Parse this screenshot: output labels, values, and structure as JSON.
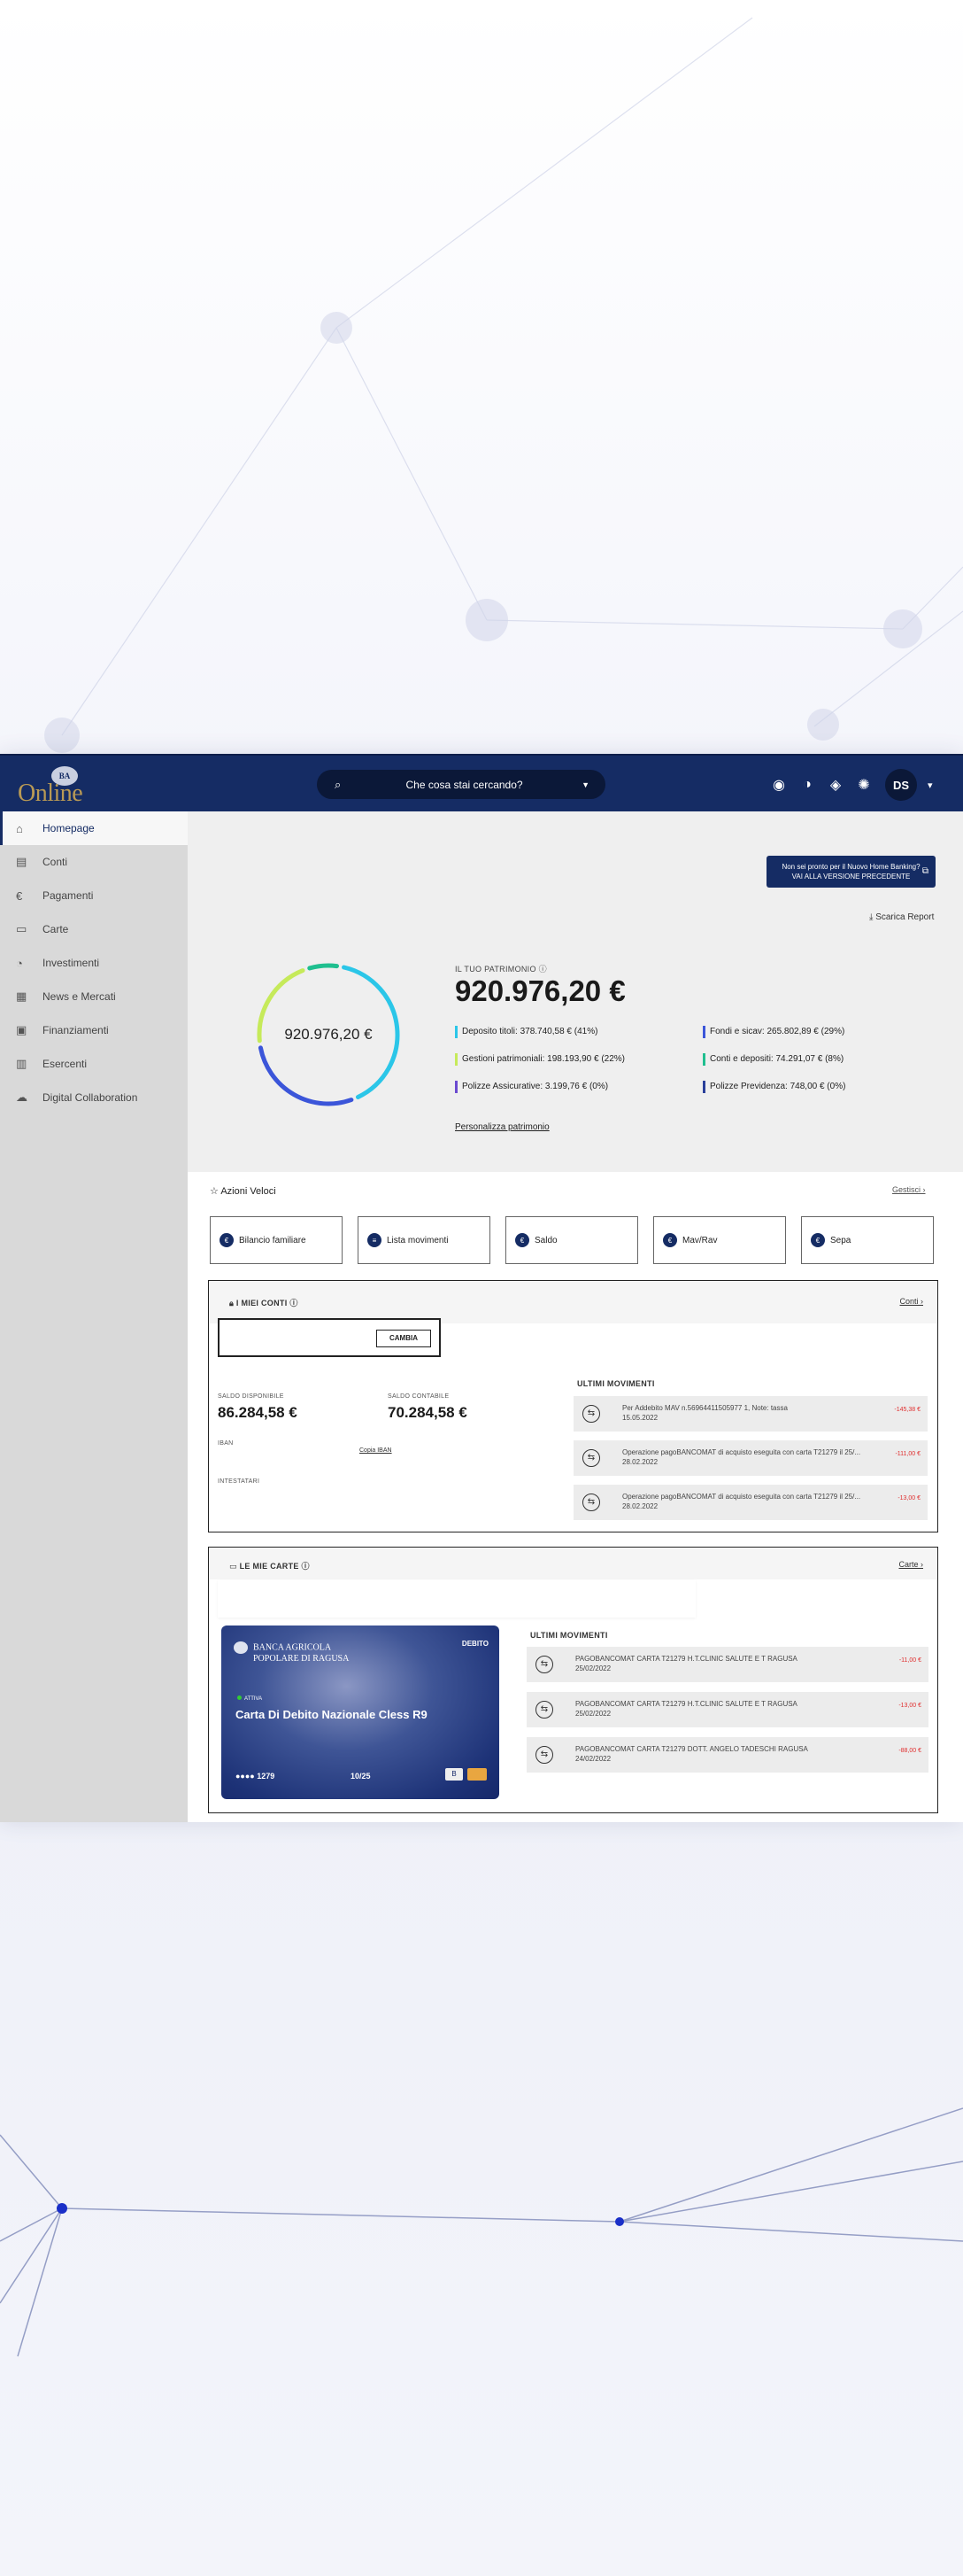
{
  "header": {
    "logo_text": "Online",
    "search_placeholder": "Che cosa stai cercando?",
    "avatar_initials": "DS"
  },
  "sidebar": {
    "items": [
      {
        "label": "Homepage",
        "icon": "home-icon"
      },
      {
        "label": "Conti",
        "icon": "bank-icon"
      },
      {
        "label": "Pagamenti",
        "icon": "euro-icon"
      },
      {
        "label": "Carte",
        "icon": "card-icon"
      },
      {
        "label": "Investimenti",
        "icon": "chart-icon"
      },
      {
        "label": "News e Mercati",
        "icon": "news-icon"
      },
      {
        "label": "Finanziamenti",
        "icon": "loan-icon"
      },
      {
        "label": "Esercenti",
        "icon": "store-icon"
      },
      {
        "label": "Digital Collaboration",
        "icon": "collab-icon"
      }
    ]
  },
  "promo": {
    "line1": "Non sei pronto per il Nuovo Home Banking?",
    "line2": "VAI ALLA VERSIONE PRECEDENTE"
  },
  "download_label": "Scarica Report",
  "patrimonio": {
    "label": "IL TUO PATRIMONIO",
    "total": "920.976,20 €",
    "ring_center": "920.976,20 €",
    "personalize": "Personalizza patrimonio",
    "items": [
      {
        "text": "Deposito titoli: 378.740,58 € (41%)",
        "color": "#2bc6e8",
        "pct": 41
      },
      {
        "text": "Fondi e sicav: 265.802,89 € (29%)",
        "color": "#3b55d9",
        "pct": 29
      },
      {
        "text": "Gestioni patrimoniali: 198.193,90 € (22%)",
        "color": "#c6ea5a",
        "pct": 22
      },
      {
        "text": "Conti e depositi: 74.291,07 € (8%)",
        "color": "#1fbf8f",
        "pct": 8
      },
      {
        "text": "Polizze Assicurative: 3.199,76 € (0%)",
        "color": "#6a4ad0",
        "pct": 0
      },
      {
        "text": "Polizze Previdenza: 748,00 € (0%)",
        "color": "#2a3f9a",
        "pct": 0
      }
    ]
  },
  "azioni": {
    "title": "Azioni Veloci",
    "manage": "Gestisci",
    "items": [
      {
        "label": "Bilancio familiare",
        "icon_char": "€"
      },
      {
        "label": "Lista movimenti",
        "icon_char": "≡"
      },
      {
        "label": "Saldo",
        "icon_char": "€"
      },
      {
        "label": "Mav/Rav",
        "icon_char": "€"
      },
      {
        "label": "Sepa",
        "icon_char": "€"
      }
    ]
  },
  "conti": {
    "title": "I MIEI CONTI",
    "link": "Conti",
    "change_button": "CAMBIA",
    "saldo_disp_label": "SALDO DISPONIBILE",
    "saldo_disp": "86.284,58 €",
    "saldo_cont_label": "SALDO CONTABILE",
    "saldo_cont": "70.284,58 €",
    "iban_label": "IBAN",
    "copy_iban": "Copia IBAN",
    "intestatari_label": "INTESTATARI",
    "movements_title": "ULTIMI MOVIMENTI",
    "movements": [
      {
        "desc": "Per Addebito MAV n.56964411505977 1, Note: tassa",
        "date": "15.05.2022",
        "amount": "-145,38 €"
      },
      {
        "desc": "Operazione pagoBANCOMAT di acquisto eseguita con carta T21279 il 25/...",
        "date": "28.02.2022",
        "amount": "-111,00 €"
      },
      {
        "desc": "Operazione pagoBANCOMAT di acquisto eseguita con carta T21279 il 25/...",
        "date": "28.02.2022",
        "amount": "-13,00 €"
      }
    ]
  },
  "carte": {
    "title": "LE MIE CARTE",
    "link": "Carte",
    "card": {
      "bank_line1": "BANCA AGRICOLA",
      "bank_line2": "POPOLARE DI RAGUSA",
      "type": "DEBITO",
      "status": "ATTIVA",
      "name": "Carta Di Debito Nazionale Cless R9",
      "number": "●●●● 1279",
      "expiry": "10/25"
    },
    "movements_title": "ULTIMI MOVIMENTI",
    "movements": [
      {
        "desc": "PAGOBANCOMAT CARTA T21279 H.T.CLINIC SALUTE E T RAGUSA",
        "date": "25/02/2022",
        "amount": "-11,00 €"
      },
      {
        "desc": "PAGOBANCOMAT CARTA T21279 H.T.CLINIC SALUTE E T RAGUSA",
        "date": "25/02/2022",
        "amount": "-13,00 €"
      },
      {
        "desc": "PAGOBANCOMAT CARTA T21279 DOTT. ANGELO TADESCHI RAGUSA",
        "date": "24/02/2022",
        "amount": "-88,00 €"
      }
    ]
  }
}
